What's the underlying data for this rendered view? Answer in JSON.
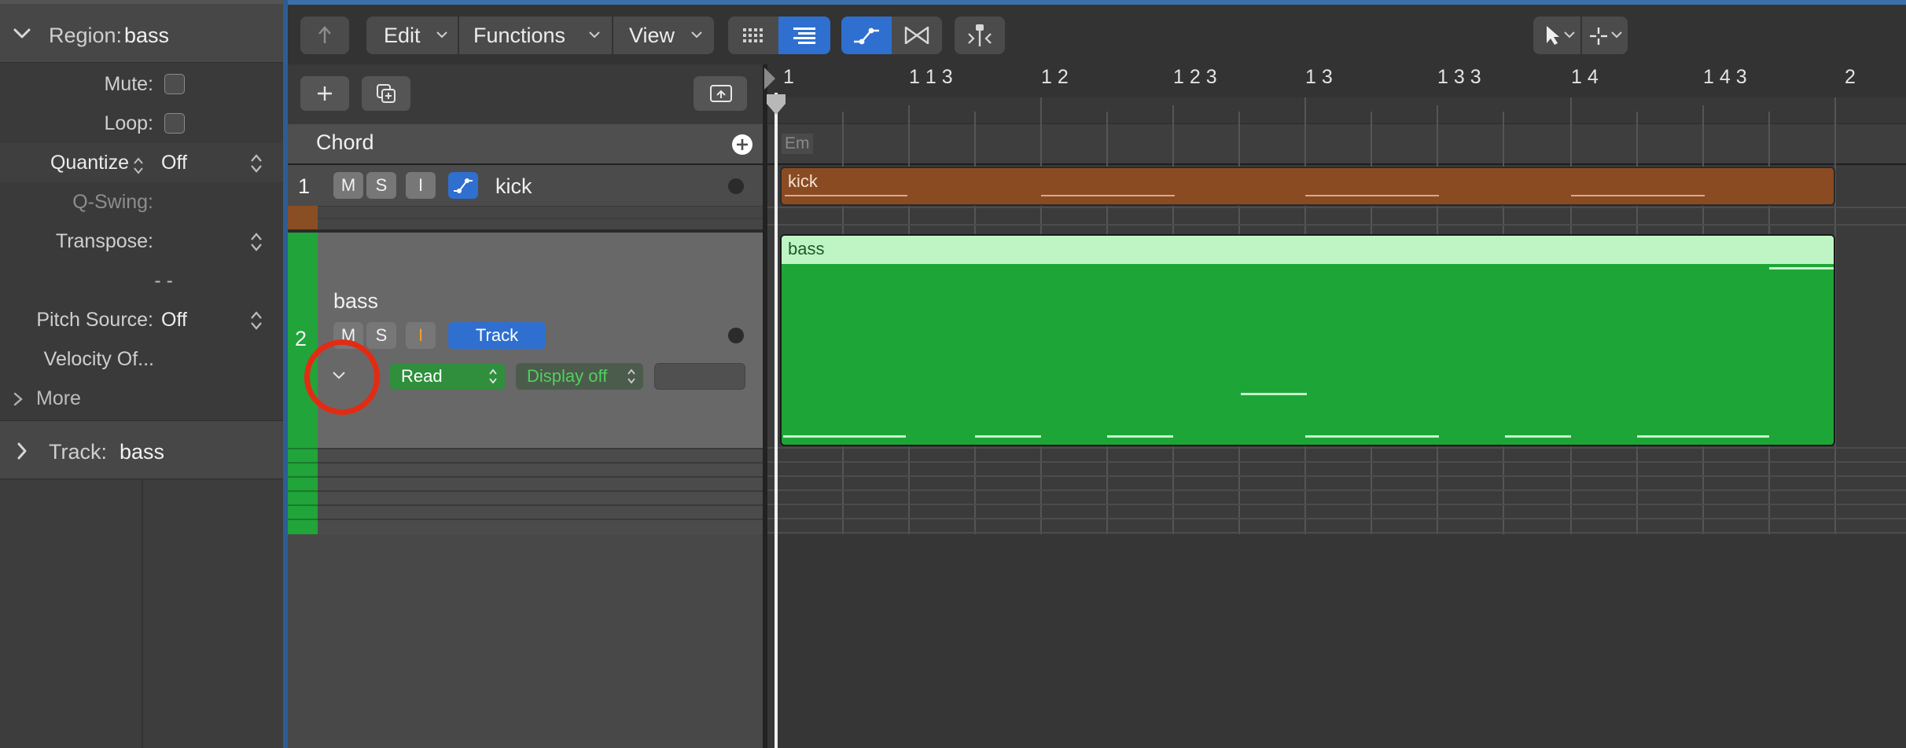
{
  "inspector": {
    "region_header": {
      "label": "Region:",
      "name": "bass"
    },
    "rows": [
      {
        "label": "Mute:",
        "type": "checkbox"
      },
      {
        "label": "Loop:",
        "type": "checkbox"
      },
      {
        "label": "Quantize",
        "value": "Off",
        "type": "popup"
      },
      {
        "label": "Q-Swing:",
        "type": "disabled"
      },
      {
        "label": "Transpose:",
        "type": "stepper"
      },
      {
        "label": "- -",
        "type": "text"
      },
      {
        "label": "Pitch Source:",
        "value": "Off",
        "type": "popup"
      },
      {
        "label": "Velocity Of...",
        "type": "text"
      },
      {
        "label": "More",
        "type": "disclosure"
      }
    ],
    "track_header": {
      "label": "Track:",
      "name": "bass"
    }
  },
  "toolbar": {
    "back_icon": "back-arrow-icon",
    "menus": [
      "Edit",
      "Functions",
      "View"
    ],
    "grid_icon": "grid-view-icon",
    "list_icon": "list-view-icon",
    "automation_icon": "automation-curve-icon",
    "flex_icon": "flex-icon",
    "catch_icon": "catch-playhead-icon",
    "pointer_tool_icon": "pointer-tool-icon",
    "crosshair_tool_icon": "crosshair-tool-icon"
  },
  "track_toolbar": {
    "add_icon": "plus-icon",
    "duplicate_icon": "duplicate-track-icon",
    "collapse_icon": "collapse-tracks-icon"
  },
  "chord_track": {
    "label": "Chord",
    "chord": "Em"
  },
  "tracks": [
    {
      "number": "1",
      "name": "kick",
      "buttons": [
        "M",
        "S",
        "I"
      ],
      "color": "#8a4b22"
    },
    {
      "number": "2",
      "name": "bass",
      "buttons": [
        "M",
        "S",
        "I"
      ],
      "track_button": "Track",
      "automation_mode": "Read",
      "automation_display": "Display off",
      "color": "#1ea537"
    }
  ],
  "ruler": {
    "marks": [
      "1",
      "1 1 3",
      "1 2",
      "1 2 3",
      "1 3",
      "1 3 3",
      "1 4",
      "1 4 3",
      "2"
    ]
  },
  "regions": [
    {
      "name": "kick",
      "color": "#8a4b22"
    },
    {
      "name": "bass",
      "color": "#1ea537"
    }
  ],
  "annotation": {
    "highlight_color": "#e32b14"
  }
}
